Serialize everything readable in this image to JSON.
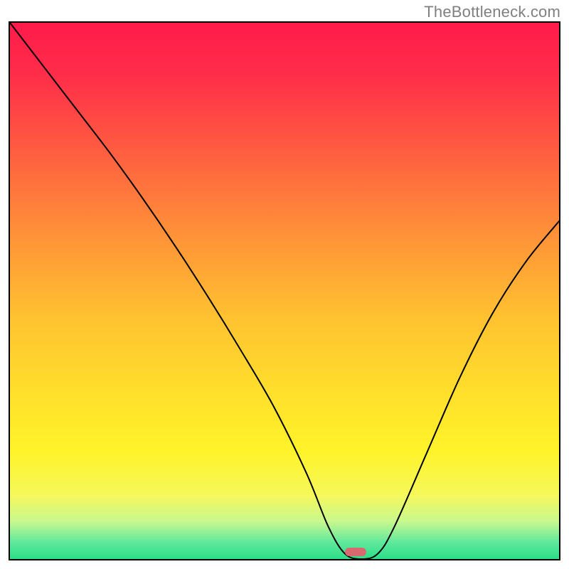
{
  "watermark": "TheBottleneck.com",
  "gradient_stops": [
    {
      "offset": 0.0,
      "color": "#ff1b4b"
    },
    {
      "offset": 0.1,
      "color": "#ff2e49"
    },
    {
      "offset": 0.25,
      "color": "#ff6140"
    },
    {
      "offset": 0.4,
      "color": "#ff9338"
    },
    {
      "offset": 0.55,
      "color": "#ffc230"
    },
    {
      "offset": 0.7,
      "color": "#ffe12b"
    },
    {
      "offset": 0.8,
      "color": "#fff32a"
    },
    {
      "offset": 0.88,
      "color": "#f6f85a"
    },
    {
      "offset": 0.93,
      "color": "#c8f88e"
    },
    {
      "offset": 0.97,
      "color": "#5de89d"
    },
    {
      "offset": 1.0,
      "color": "#2bde87"
    }
  ],
  "marker": {
    "color": "#d9696f",
    "x_frac": 0.63,
    "y_frac": 0.987
  },
  "chart_data": {
    "type": "line",
    "title": "",
    "xlabel": "",
    "ylabel": "",
    "xlim": [
      0,
      1
    ],
    "ylim": [
      0,
      1
    ],
    "series": [
      {
        "name": "curve",
        "x": [
          0.0,
          0.06,
          0.12,
          0.18,
          0.24,
          0.3,
          0.36,
          0.42,
          0.48,
          0.54,
          0.58,
          0.61,
          0.64,
          0.67,
          0.7,
          0.76,
          0.82,
          0.88,
          0.94,
          1.0
        ],
        "y": [
          1.0,
          0.92,
          0.84,
          0.76,
          0.675,
          0.585,
          0.49,
          0.39,
          0.285,
          0.16,
          0.06,
          0.01,
          0.0,
          0.01,
          0.06,
          0.2,
          0.34,
          0.46,
          0.555,
          0.63
        ]
      }
    ],
    "marker_point": {
      "x": 0.63,
      "y": 0.013
    }
  }
}
